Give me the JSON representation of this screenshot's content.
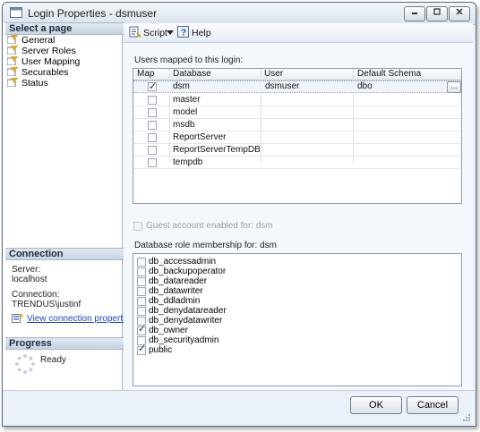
{
  "window": {
    "title": "Login Properties - dsmuser",
    "controls": [
      "minimize",
      "maximize",
      "close"
    ]
  },
  "left_pane": {
    "select_page_header": "Select a page",
    "pages": [
      {
        "label": "General"
      },
      {
        "label": "Server Roles"
      },
      {
        "label": "User Mapping"
      },
      {
        "label": "Securables"
      },
      {
        "label": "Status"
      }
    ],
    "connection": {
      "header": "Connection",
      "server_label": "Server:",
      "server_value": "localhost",
      "connection_label": "Connection:",
      "connection_value": "TRENDUS\\justinf",
      "link": "View connection properties"
    },
    "progress": {
      "header": "Progress",
      "status": "Ready"
    }
  },
  "toolbar": {
    "script_label": "Script",
    "help_label": "Help"
  },
  "users_mapped": {
    "label": "Users mapped to this login:",
    "columns": [
      "Map",
      "Database",
      "User",
      "Default Schema"
    ],
    "rows": [
      {
        "map": true,
        "database": "dsm",
        "user": "dsmuser",
        "schema": "dbo"
      },
      {
        "map": false,
        "database": "master",
        "user": "",
        "schema": ""
      },
      {
        "map": false,
        "database": "model",
        "user": "",
        "schema": ""
      },
      {
        "map": false,
        "database": "msdb",
        "user": "",
        "schema": ""
      },
      {
        "map": false,
        "database": "ReportServer",
        "user": "",
        "schema": ""
      },
      {
        "map": false,
        "database": "ReportServerTempDB",
        "user": "",
        "schema": ""
      },
      {
        "map": false,
        "database": "tempdb",
        "user": "",
        "schema": ""
      }
    ],
    "ellipsis": "..."
  },
  "guest_account": {
    "label": "Guest account enabled for: dsm",
    "checked": false
  },
  "role_membership": {
    "label": "Database role membership for: dsm",
    "roles": [
      {
        "name": "db_accessadmin",
        "checked": false
      },
      {
        "name": "db_backupoperator",
        "checked": false
      },
      {
        "name": "db_datareader",
        "checked": false
      },
      {
        "name": "db_datawriter",
        "checked": false
      },
      {
        "name": "db_ddladmin",
        "checked": false
      },
      {
        "name": "db_denydatareader",
        "checked": false
      },
      {
        "name": "db_denydatawriter",
        "checked": false
      },
      {
        "name": "db_owner",
        "checked": true
      },
      {
        "name": "db_securityadmin",
        "checked": false
      },
      {
        "name": "public",
        "checked": true
      }
    ]
  },
  "buttons": {
    "ok": "OK",
    "cancel": "Cancel"
  }
}
